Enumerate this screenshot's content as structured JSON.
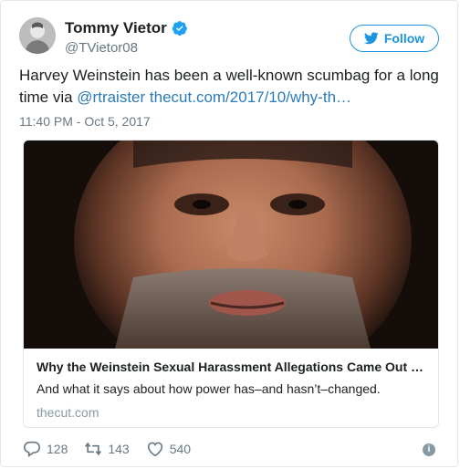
{
  "author": {
    "name": "Tommy Vietor",
    "handle": "@TVietor08",
    "verified_icon": "verified-badge-icon"
  },
  "follow": {
    "label": "Follow",
    "icon": "twitter-bird-icon"
  },
  "tweet": {
    "text_prefix": "Harvey Weinstein has been a well-known scumbag for a long time via ",
    "mention": "@rtraister",
    "link": "thecut.com/2017/10/why-th…",
    "timestamp": "11:40 PM - Oct 5, 2017"
  },
  "card": {
    "title": "Why the Weinstein Sexual Harassment Allegations Came Out …",
    "description": "And what it says about how power has–and hasn’t–changed.",
    "domain": "thecut.com"
  },
  "actions": {
    "replies": "128",
    "retweets": "143",
    "likes": "540",
    "info_icon": "info-icon"
  },
  "colors": {
    "accent": "#1b95e0",
    "link": "#2b7bb9",
    "muted": "#697882",
    "border": "#e1e8ed"
  }
}
